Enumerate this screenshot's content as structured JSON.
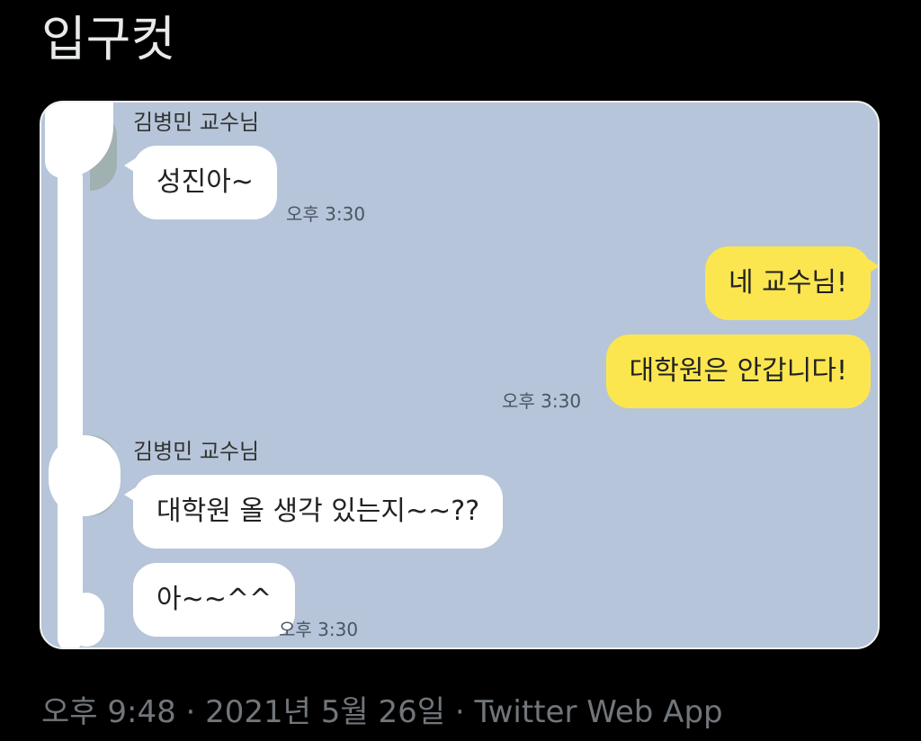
{
  "tweet": {
    "text": "입구컷"
  },
  "chat": {
    "background_color": "#b6c5d9",
    "incoming_color": "#ffffff",
    "outgoing_color": "#fbe650",
    "groups": [
      {
        "sender": "김병민 교수님",
        "messages": [
          "성진아~"
        ],
        "time": "오후 3:30"
      },
      {
        "sender": "",
        "messages": [
          "네 교수님!",
          "대학원은 안갑니다!"
        ],
        "time": "오후 3:30"
      },
      {
        "sender": "김병민 교수님",
        "messages": [
          "대학원 올 생각 있는지~~??",
          "아~~^^"
        ],
        "time": "오후 3:30"
      }
    ]
  },
  "meta": {
    "time": "오후 9:48",
    "separator": " · ",
    "date": "2021년 5월 26일",
    "source": "Twitter Web App"
  }
}
